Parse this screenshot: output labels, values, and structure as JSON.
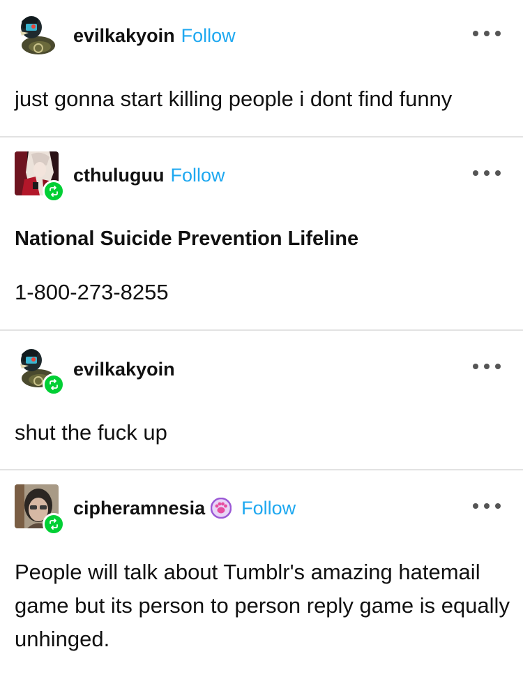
{
  "posts": [
    {
      "username": "evilkakyoin",
      "follow_label": "Follow",
      "avatar": "rubber-duck-avatar",
      "text": "just gonna start killing people i dont find funny"
    },
    {
      "username": "cthuluguu",
      "follow_label": "Follow",
      "avatar": "anime-vampire-avatar",
      "reblog_icon": "reblog-icon",
      "title": "National Suicide Prevention Lifeline",
      "text": "1-800-273-8255"
    },
    {
      "username": "evilkakyoin",
      "avatar": "rubber-duck-avatar",
      "reblog_icon": "reblog-icon",
      "text": "shut the fuck up"
    },
    {
      "username": "cipheramnesia",
      "follow_label": "Follow",
      "avatar": "person-photo-avatar",
      "badge_icon": "paw-badge-icon",
      "reblog_icon": "reblog-icon",
      "text": "People will talk about Tumblr's amazing hatemail game but its person to person reply game is equally unhinged."
    }
  ],
  "colors": {
    "follow": "#1ea8f0",
    "reblog_badge": "#01cf35",
    "divider": "#e2e2e2",
    "paw_badge": "#9b59d6"
  }
}
